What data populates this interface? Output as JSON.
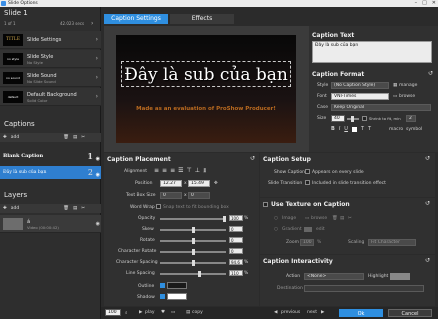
{
  "window": {
    "title": "Slide Options",
    "controls": [
      "–",
      "□",
      "✕"
    ]
  },
  "left": {
    "slide_header": "Slide 1",
    "slide_counter": "1 of 1",
    "slide_duration": "42.023 secs",
    "slide_items": [
      {
        "title": "Slide Settings",
        "sub": "",
        "thumb": "TITLE",
        "thumb_color": "#c7a24a"
      },
      {
        "title": "Slide Style",
        "sub": "No Style",
        "thumb": "no style",
        "thumb_color": "#ffffff"
      },
      {
        "title": "Slide Sound",
        "sub": "No Slide Sound",
        "thumb": "no sound",
        "thumb_color": "#ffffff"
      },
      {
        "title": "Default Background",
        "sub": "Solid Color",
        "thumb": "default",
        "thumb_color": "#ffffff"
      }
    ],
    "captions_header": "Captions",
    "add_label": "add",
    "captions": [
      {
        "text": "Blank Caption",
        "num": "1",
        "selected": false
      },
      {
        "text": "Đây là sub của bạn",
        "num": "2",
        "selected": true
      }
    ],
    "layers_header": "Layers",
    "layers": [
      {
        "name": "á",
        "sub": "Video (00:00:42)"
      }
    ]
  },
  "tabs": [
    {
      "label": "Caption Settings",
      "active": true
    },
    {
      "label": "Effects",
      "active": false
    }
  ],
  "stage": {
    "subtitle": "Đây là sub của bạn",
    "watermark": "Made as an evaluation of ProShow Producer!"
  },
  "caption_text": {
    "header": "Caption Text",
    "value": "Đây là sub của bạn"
  },
  "caption_format": {
    "header": "Caption Format",
    "style_label": "Style",
    "style_value": "(No Caption Style)",
    "manage_label": "manage",
    "font_label": "Font",
    "font_value": "VNI-Times",
    "browse_label": "browse",
    "case_label": "Case",
    "case_value": "Keep Original",
    "size_label": "Size",
    "size_value": "40",
    "shrink_label": "Shrink to fit, min",
    "shrink_value": "2",
    "macro_label": "macro",
    "symbol_label": "symbol"
  },
  "caption_placement": {
    "header": "Caption Placement",
    "alignment_label": "Alignment",
    "position_label": "Position",
    "position_x": "12.27",
    "position_y": "15.49",
    "textbox_label": "Text Box Size",
    "textbox_x": "0",
    "textbox_y": "0",
    "wordwrap_label": "Word Wrap",
    "snap_label": "Snap text to fit bounding box",
    "sliders": [
      {
        "label": "Opacity",
        "value": "100",
        "unit": "%",
        "pos": 1.0
      },
      {
        "label": "Skew",
        "value": "0",
        "unit": "",
        "pos": 0.5
      },
      {
        "label": "Rotate",
        "value": "0",
        "unit": "",
        "pos": 0.5
      },
      {
        "label": "Character Rotate",
        "value": "0",
        "unit": "",
        "pos": 0.5
      },
      {
        "label": "Character Spacing",
        "value": "0",
        "unit": "",
        "pos": 0.5
      },
      {
        "label": "Line Spacing",
        "value": "94.6",
        "unit": "%",
        "pos": 0.55
      },
      {
        "label": "Line Spacing",
        "value": "110",
        "unit": "%",
        "pos": 0.6
      }
    ],
    "outline_label": "Outline",
    "shadow_label": "Shadow",
    "outline_color": "#1a1a1a",
    "shadow_color": "#ffffff"
  },
  "caption_setup": {
    "header": "Caption Setup",
    "show_label": "Show Caption",
    "show_opt": "Appears on every slide",
    "transition_label": "Slide Transition",
    "transition_opt": "Included in slide transition effect"
  },
  "texture": {
    "header": "Use Texture on Caption",
    "image_label": "Image",
    "browse_label": "browse",
    "gradient_label": "Gradient",
    "edit_label": "edit",
    "zoom_label": "Zoom",
    "zoom_value": "100",
    "scaling_label": "Scaling",
    "scaling_value": "Fit Character"
  },
  "interactivity": {
    "header": "Caption Interactivity",
    "action_label": "Action",
    "action_value": "<None>",
    "highlight_label": "Highlight",
    "destination_label": "Destination"
  },
  "bottom": {
    "zoom_value": "100",
    "play_label": "play",
    "copy_label": "copy",
    "previous_label": "previous",
    "next_label": "next",
    "ok_label": "Ok",
    "cancel_label": "Cancel"
  },
  "colors": {
    "accent": "#2f8fe0",
    "selected_caption": "#2f7fd0"
  }
}
